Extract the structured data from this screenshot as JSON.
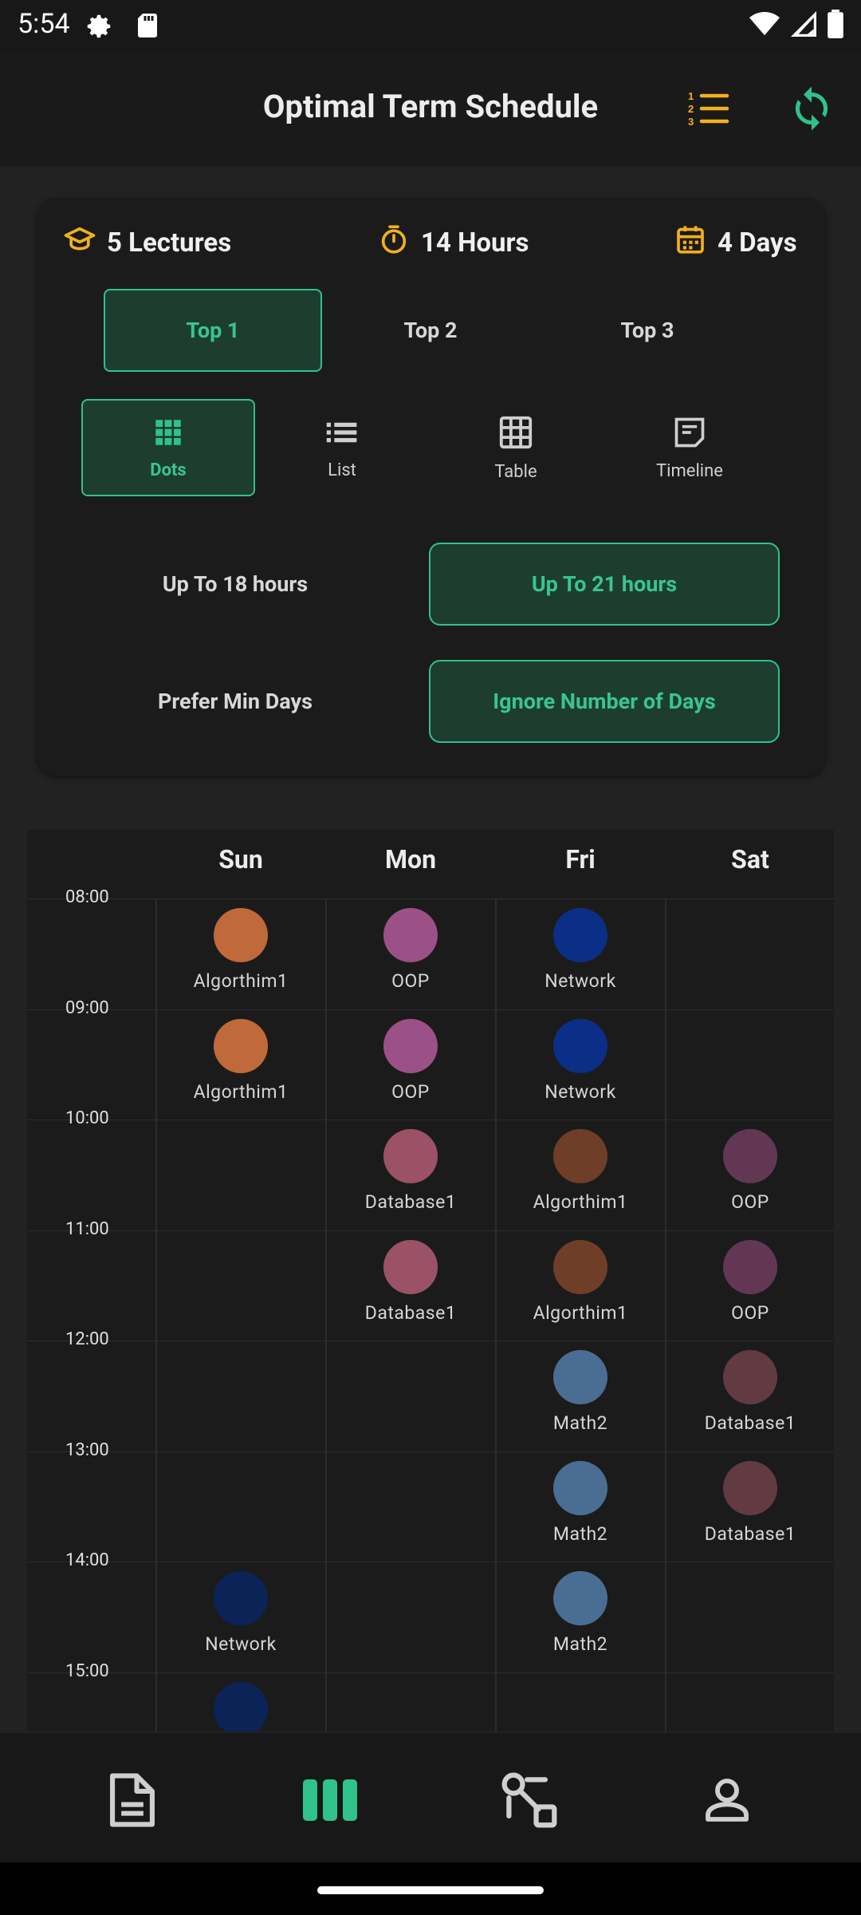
{
  "status_bar": {
    "time": "5:54",
    "left_icons": [
      "gear-icon",
      "sd-card-icon"
    ],
    "right_icons": [
      "wifi-icon",
      "signal-icon",
      "battery-icon"
    ]
  },
  "app_bar": {
    "title": "Optimal Term Schedule",
    "actions": [
      "numbered-list-icon",
      "refresh-icon"
    ]
  },
  "summary": {
    "lectures": "5 Lectures",
    "hours": "14 Hours",
    "days": "4 Days",
    "accent_color": "#f2b01e"
  },
  "top_tabs": [
    {
      "label": "Top 1",
      "active": true
    },
    {
      "label": "Top 2",
      "active": false
    },
    {
      "label": "Top 3",
      "active": false
    }
  ],
  "view_modes": [
    {
      "label": "Dots",
      "icon": "dots-grid-icon",
      "active": true
    },
    {
      "label": "List",
      "icon": "list-icon",
      "active": false
    },
    {
      "label": "Table",
      "icon": "table-icon",
      "active": false
    },
    {
      "label": "Timeline",
      "icon": "timeline-icon",
      "active": false
    }
  ],
  "hours_options": [
    {
      "label": "Up To 18 hours",
      "active": false
    },
    {
      "label": "Up To 21 hours",
      "active": true
    }
  ],
  "days_options": [
    {
      "label": "Prefer Min Days",
      "active": false
    },
    {
      "label": "Ignore Number of Days",
      "active": true
    }
  ],
  "schedule": {
    "days": [
      "Sun",
      "Mon",
      "Fri",
      "Sat"
    ],
    "times": [
      "08:00",
      "09:00",
      "10:00",
      "11:00",
      "12:00",
      "13:00",
      "14:00",
      "15:00"
    ],
    "cells": [
      {
        "day": 0,
        "slot": 0,
        "label": "Algorthim1",
        "color": "#c0693a"
      },
      {
        "day": 1,
        "slot": 0,
        "label": "OOP",
        "color": "#9b5188"
      },
      {
        "day": 2,
        "slot": 0,
        "label": "Network",
        "color": "#0b2f86"
      },
      {
        "day": 0,
        "slot": 1,
        "label": "Algorthim1",
        "color": "#c0693a"
      },
      {
        "day": 1,
        "slot": 1,
        "label": "OOP",
        "color": "#9b5188"
      },
      {
        "day": 2,
        "slot": 1,
        "label": "Network",
        "color": "#0b2f86"
      },
      {
        "day": 1,
        "slot": 2,
        "label": "Database1",
        "color": "#9b5266"
      },
      {
        "day": 2,
        "slot": 2,
        "label": "Algorthim1",
        "color": "#6e3e27"
      },
      {
        "day": 3,
        "slot": 2,
        "label": "OOP",
        "color": "#623754"
      },
      {
        "day": 1,
        "slot": 3,
        "label": "Database1",
        "color": "#9b5266"
      },
      {
        "day": 2,
        "slot": 3,
        "label": "Algorthim1",
        "color": "#6e3e27"
      },
      {
        "day": 3,
        "slot": 3,
        "label": "OOP",
        "color": "#623754"
      },
      {
        "day": 2,
        "slot": 4,
        "label": "Math2",
        "color": "#4a6e93"
      },
      {
        "day": 3,
        "slot": 4,
        "label": "Database1",
        "color": "#623a41"
      },
      {
        "day": 2,
        "slot": 5,
        "label": "Math2",
        "color": "#4a6e93"
      },
      {
        "day": 3,
        "slot": 5,
        "label": "Database1",
        "color": "#623a41"
      },
      {
        "day": 0,
        "slot": 6,
        "label": "Network",
        "color": "#0b2357"
      },
      {
        "day": 2,
        "slot": 6,
        "label": "Math2",
        "color": "#4a6e93"
      },
      {
        "day": 0,
        "slot": 7,
        "label": "",
        "color": "#0b2357"
      }
    ]
  },
  "bottom_nav": [
    {
      "icon": "document-icon",
      "active": false
    },
    {
      "icon": "schedule-columns-icon",
      "active": true
    },
    {
      "icon": "route-icon",
      "active": false
    },
    {
      "icon": "profile-icon",
      "active": false
    }
  ],
  "colors": {
    "accent_green": "#2fc28b",
    "active_bg": "#1e3d31",
    "amber": "#f2b01e",
    "background": "#222222"
  }
}
